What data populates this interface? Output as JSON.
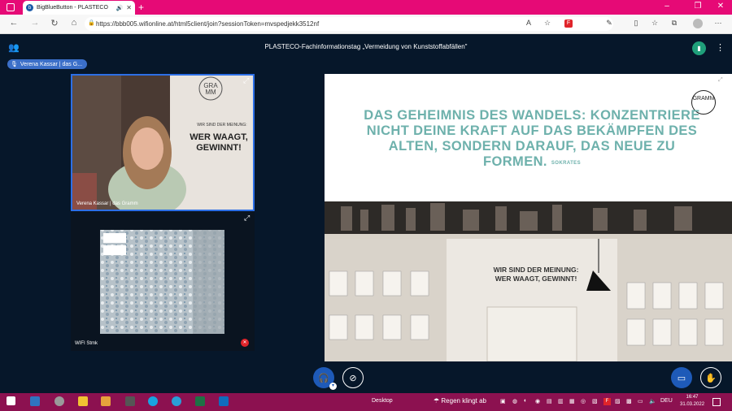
{
  "browser": {
    "tab_title": "BigBlueButton - PLASTECO",
    "tab_favicon": "b",
    "new_tab": "+",
    "url": "https://bbb005.wifionline.at/html5client/join?sessionToken=mvspedjekk3512nf",
    "window_controls": [
      "–",
      "❐",
      "✕"
    ]
  },
  "meeting": {
    "title": "PLASTECO-Fachinformationstag „Vermeidung von Kunststoffabfällen\"",
    "talking_indicator": "Verena Kassar | das G..."
  },
  "webcams": [
    {
      "name": "Verena Kassar | das Gramm",
      "poster_text": "WER WAAGT, GEWINNT!",
      "poster_small": "WIR SIND DER MEINUNG:"
    },
    {
      "name": "WIFI Stmk"
    }
  ],
  "slide": {
    "quote": "DAS GEHEIMNIS DES WANDELS: KONZENTRIERE NICHT DEINE KRAFT AUF DAS BEKÄMPFEN DES ALTEN, SONDERN DARAUF, DAS NEUE ZU FORMEN.",
    "author": "SOKRATES",
    "logo": "GRAMM",
    "shop_sign_line1": "WIR SIND DER MEINUNG:",
    "shop_sign_line2": "WER WAAGT, GEWINNT!"
  },
  "taskbar": {
    "desktop_label": "Desktop",
    "weather_text": "Regen klingt ab",
    "language": "DEU",
    "time": "16:47",
    "date": "31.03.2022"
  },
  "colors": {
    "accent_pink": "#e60a76",
    "bbb_dark": "#06172a",
    "bbb_blue": "#1e5ab8",
    "quote_teal": "#6eb1ac",
    "taskbar": "#8c1150"
  }
}
